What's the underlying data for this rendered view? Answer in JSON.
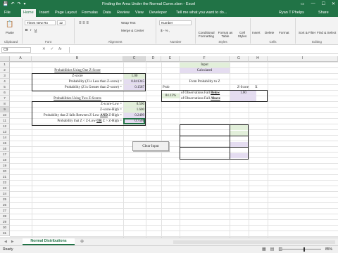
{
  "titlebar": {
    "title": "Finding the Area Under the Normal Curve.xlsm - Excel",
    "qat": [
      "💾",
      "↶",
      "↷",
      "▾"
    ],
    "window_buttons": [
      "▭",
      "—",
      "☐",
      "✕"
    ]
  },
  "tabs": {
    "items": [
      "File",
      "Home",
      "Insert",
      "Page Layout",
      "Formulas",
      "Data",
      "Review",
      "View",
      "Developer"
    ],
    "active": "Home",
    "tell_me": "Tell me what you want to do...",
    "user": "Ryan T Phelps",
    "share": "Share"
  },
  "ribbon": {
    "clipboard": {
      "paste": "Paste",
      "label": "Clipboard"
    },
    "font": {
      "name": "Times New Ro",
      "size": "12",
      "label": "Font",
      "bold": "B",
      "italic": "I",
      "underline": "U"
    },
    "alignment": {
      "wrap": "Wrap Text",
      "merge": "Merge & Center",
      "label": "Alignment"
    },
    "number": {
      "format": "Number",
      "label": "Number",
      "currency": "$ - % ,"
    },
    "styles": {
      "conditional": "Conditional Formatting",
      "format_table": "Format as Table",
      "cell_styles": "Cell Styles",
      "label": "Styles"
    },
    "cells": {
      "insert": "Insert",
      "delete": "Delete",
      "format": "Format",
      "label": "Cells"
    },
    "editing": {
      "sort": "Sort & Filter",
      "find": "Find & Select",
      "label": "Editing"
    }
  },
  "formula_bar": {
    "name_box": "C9",
    "fx": "fx",
    "value": ""
  },
  "columns": [
    "A",
    "B",
    "C",
    "D",
    "E",
    "F",
    "G",
    "H",
    "I"
  ],
  "rows": [
    "1",
    "2",
    "3",
    "4",
    "5",
    "6",
    "7",
    "8",
    "9",
    "10",
    "11",
    "12",
    "13",
    "14",
    "15",
    "16",
    "17",
    "18",
    "19",
    "20",
    "21",
    "22",
    "23",
    "24",
    "25",
    "26",
    "27",
    "28",
    "29",
    "30",
    "31"
  ],
  "sheet": {
    "input_label": "Input",
    "calculated_label": "Calculated",
    "one_z_title": "Probabilities Using One Z-Score",
    "z_score_label": "Z-score",
    "z_score_value": "1.00",
    "prob_less_label": "Probability (Z is Less than Z-score) =",
    "prob_less_value": "0.841345",
    "prob_greater_label": "Probability (Z is Greater than Z-score) =",
    "prob_greater_value": "0.1587",
    "two_z_title": "Probabilities Using Two Z-Scores",
    "z_low_label": "Z-score-Low =",
    "z_low_value": "0.500",
    "z_high_label": "Z-score-High =",
    "z_high_value": "1.600",
    "prob_between_label_pre": "Probability that Z falls Between Z-Low",
    "prob_between_and": "AND",
    "prob_between_label_post": "Z-High =",
    "prob_between_value": "0.2499",
    "prob_outside_label_pre": "Probability that Z < Z-Low",
    "prob_outside_or": "OR",
    "prob_outside_label_post": "Z > Z-High =",
    "prob_outside_value": "0.7501",
    "from_prob_title": "From Probability to Z",
    "prob_header": "Prob",
    "z_score_header": "Z-Score",
    "x_header": "X",
    "prob_value": "84.13%",
    "below_pre": "of Observations Fall",
    "below_word": "Below",
    "above_pre": "of Observations Fall",
    "above_word": "Above",
    "z_result": "1.00",
    "clear_button": "Clear Input"
  },
  "sheet_tabs": {
    "active": "Normal Distributions",
    "add": "⊕"
  },
  "status": {
    "ready": "Ready",
    "zoom": "85%"
  },
  "colors": {
    "excel_green": "#217346",
    "input_fill": "#e2efda",
    "calc_fill": "#e4dcf0"
  }
}
